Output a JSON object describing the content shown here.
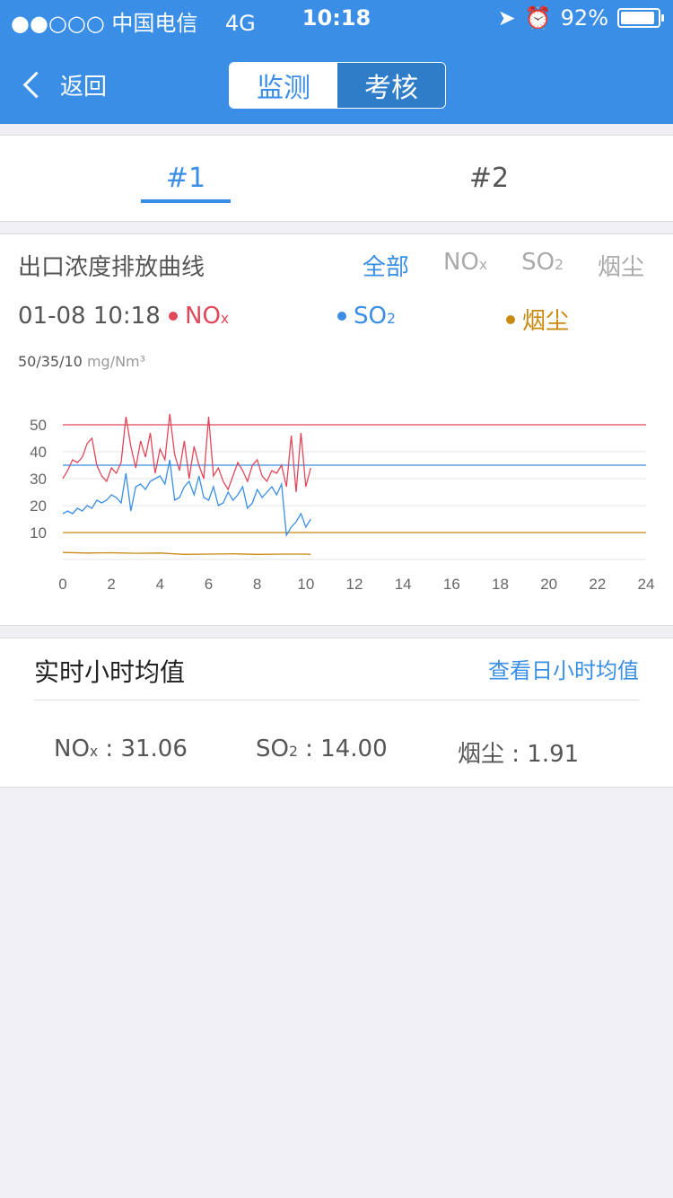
{
  "status": {
    "carrier": "●●○○○ 中国电信",
    "network": "4G",
    "time": "10:18",
    "battery": "92%"
  },
  "nav": {
    "back_label": "返回",
    "segments": [
      "监测",
      "考核"
    ],
    "active_segment": 0
  },
  "tabs": {
    "items": [
      "#1",
      "#2"
    ],
    "active": 0
  },
  "chart_card": {
    "title": "出口浓度排放曲线",
    "filters": [
      {
        "base": "全部",
        "sub": ""
      },
      {
        "base": "NO",
        "sub": "x"
      },
      {
        "base": "SO",
        "sub": "2"
      },
      {
        "base": "烟尘",
        "sub": ""
      }
    ],
    "active_filter": 0,
    "timestamp": "01-08 10:18",
    "legend": [
      {
        "base": "NO",
        "sub": "x",
        "color": "#e0485a"
      },
      {
        "base": "SO",
        "sub": "2",
        "color": "#3a8ee6"
      },
      {
        "base": "烟尘",
        "sub": "",
        "color": "#c98a12"
      }
    ],
    "limits_text": "50/35/10",
    "unit_text": "mg/Nm³"
  },
  "chart_data": {
    "type": "line",
    "x_ticks": [
      "0",
      "2",
      "4",
      "6",
      "8",
      "10",
      "12",
      "14",
      "16",
      "18",
      "20",
      "22",
      "24"
    ],
    "y_ticks": [
      "50",
      "40",
      "30",
      "20",
      "10"
    ],
    "xlim": [
      0,
      24
    ],
    "ylim": [
      0,
      55
    ],
    "limit_lines": [
      {
        "name": "NOx",
        "value": 50,
        "color": "#e0485a"
      },
      {
        "name": "SO2",
        "value": 35,
        "color": "#3a8ee6"
      },
      {
        "name": "烟尘",
        "value": 10,
        "color": "#c98a12"
      }
    ],
    "series": [
      {
        "name": "NOx",
        "color": "#e0485a",
        "x": [
          0,
          0.2,
          0.4,
          0.6,
          0.8,
          1.0,
          1.2,
          1.4,
          1.6,
          1.8,
          2.0,
          2.2,
          2.4,
          2.6,
          2.8,
          3.0,
          3.2,
          3.4,
          3.6,
          3.8,
          4.0,
          4.2,
          4.4,
          4.6,
          4.8,
          5.0,
          5.2,
          5.4,
          5.6,
          5.8,
          6.0,
          6.2,
          6.4,
          6.6,
          6.8,
          7.0,
          7.2,
          7.4,
          7.6,
          7.8,
          8.0,
          8.2,
          8.4,
          8.6,
          8.8,
          9.0,
          9.2,
          9.4,
          9.6,
          9.8,
          10.0,
          10.2
        ],
        "y": [
          30,
          33,
          37,
          36,
          38,
          43,
          45,
          35,
          31,
          29,
          34,
          32,
          36,
          53,
          42,
          34,
          44,
          38,
          47,
          32,
          41,
          37,
          54,
          39,
          33,
          44,
          30,
          42,
          35,
          30,
          53,
          31,
          34,
          29,
          26,
          31,
          36,
          33,
          29,
          35,
          37,
          31,
          29,
          33,
          32,
          35,
          27,
          46,
          25,
          47,
          27,
          34
        ]
      },
      {
        "name": "SO2",
        "color": "#3a8ee6",
        "x": [
          0,
          0.2,
          0.4,
          0.6,
          0.8,
          1.0,
          1.2,
          1.4,
          1.6,
          1.8,
          2.0,
          2.2,
          2.4,
          2.6,
          2.8,
          3.0,
          3.2,
          3.4,
          3.6,
          3.8,
          4.0,
          4.2,
          4.4,
          4.6,
          4.8,
          5.0,
          5.2,
          5.4,
          5.6,
          5.8,
          6.0,
          6.2,
          6.4,
          6.6,
          6.8,
          7.0,
          7.2,
          7.4,
          7.6,
          7.8,
          8.0,
          8.2,
          8.4,
          8.6,
          8.8,
          9.0,
          9.2,
          9.4,
          9.6,
          9.8,
          10.0,
          10.2
        ],
        "y": [
          17,
          18,
          17,
          19,
          18,
          20,
          19,
          22,
          21,
          22,
          24,
          23,
          21,
          32,
          18,
          27,
          28,
          26,
          29,
          30,
          31,
          28,
          37,
          22,
          23,
          27,
          29,
          24,
          31,
          23,
          22,
          27,
          20,
          21,
          25,
          22,
          24,
          27,
          19,
          21,
          26,
          23,
          25,
          27,
          24,
          28,
          9,
          12,
          14,
          17,
          12,
          15
        ]
      },
      {
        "name": "烟尘",
        "color": "#c98a12",
        "x": [
          0,
          1,
          2,
          3,
          4,
          5,
          6,
          7,
          8,
          9,
          10,
          10.2
        ],
        "y": [
          2.6,
          2.4,
          2.5,
          2.3,
          2.4,
          1.9,
          2.0,
          2.1,
          1.9,
          2.0,
          2.0,
          1.9
        ]
      }
    ]
  },
  "hourly": {
    "title": "实时小时均值",
    "link": "查看日小时均值",
    "values": [
      {
        "base": "NO",
        "sub": "x",
        "val": " : 31.06"
      },
      {
        "base": "SO",
        "sub": "2",
        "val": " : 14.00"
      },
      {
        "base": "烟尘",
        "sub": "",
        "val": " : 1.91"
      }
    ]
  }
}
